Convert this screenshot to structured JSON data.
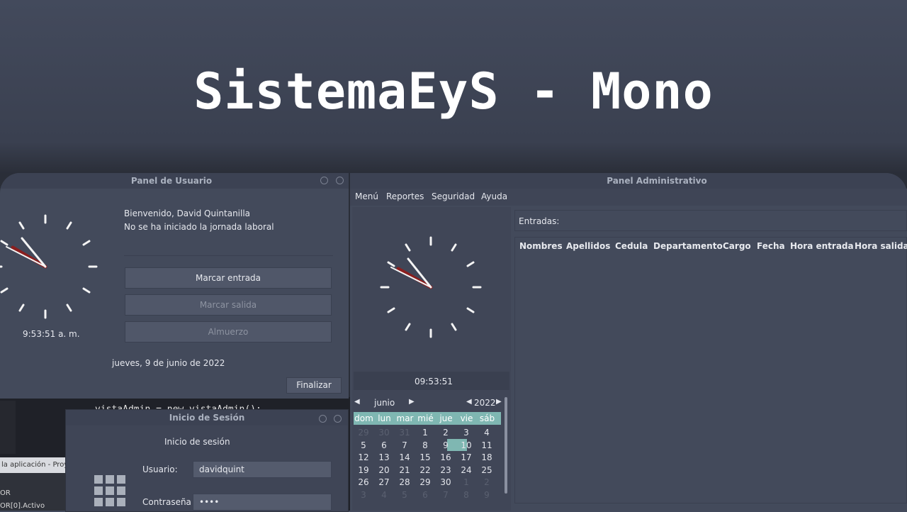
{
  "banner": {
    "title": "SistemaEyS - Mono"
  },
  "user_panel": {
    "title": "Panel de Usuario",
    "welcome": "Bienvenido, David Quintanilla",
    "status": "No se ha iniciado la jornada laboral",
    "clock_time": "9:53:51 a. m.",
    "date": "jueves, 9 de junio de 2022",
    "buttons": {
      "check_in": "Marcar entrada",
      "check_out": "Marcar salida",
      "lunch": "Almuerzo",
      "finish": "Finalizar"
    }
  },
  "admin_panel": {
    "title": "Panel Administrativo",
    "menu": [
      "Menú",
      "Reportes",
      "Seguridad",
      "Ayuda"
    ],
    "entries_label": "Entradas:",
    "columns": [
      "Nombres",
      "Apellidos",
      "Cedula",
      "Departamento",
      "Cargo",
      "Fecha",
      "Hora entrada",
      "Hora salida"
    ],
    "clock_time": "09:53:51",
    "calendar": {
      "month": "junio",
      "year": "2022",
      "weekdays": [
        "dom",
        "lun",
        "mar",
        "mié",
        "jue",
        "vie",
        "sáb"
      ],
      "rows": [
        [
          "29",
          "30",
          "31",
          "1",
          "2",
          "3",
          "4"
        ],
        [
          "5",
          "6",
          "7",
          "8",
          "9",
          "10",
          "11"
        ],
        [
          "12",
          "13",
          "14",
          "15",
          "16",
          "17",
          "18"
        ],
        [
          "19",
          "20",
          "21",
          "22",
          "23",
          "24",
          "25"
        ],
        [
          "26",
          "27",
          "28",
          "29",
          "30",
          "1",
          "2"
        ],
        [
          "3",
          "4",
          "5",
          "6",
          "7",
          "8",
          "9"
        ]
      ],
      "selected_day": "9"
    }
  },
  "login": {
    "title": "Inicio de Sesión",
    "heading": "Inicio de sesión",
    "user_label": "Usuario:",
    "user_value": "davidquint",
    "password_label": "Contraseña",
    "password_value": "••••"
  },
  "ide": {
    "code_line": "vistaAdmin = new vistaAdmin();",
    "bar_text": "la aplicación - Proye",
    "line1": "OR",
    "line2": "OR[0].Activo"
  }
}
